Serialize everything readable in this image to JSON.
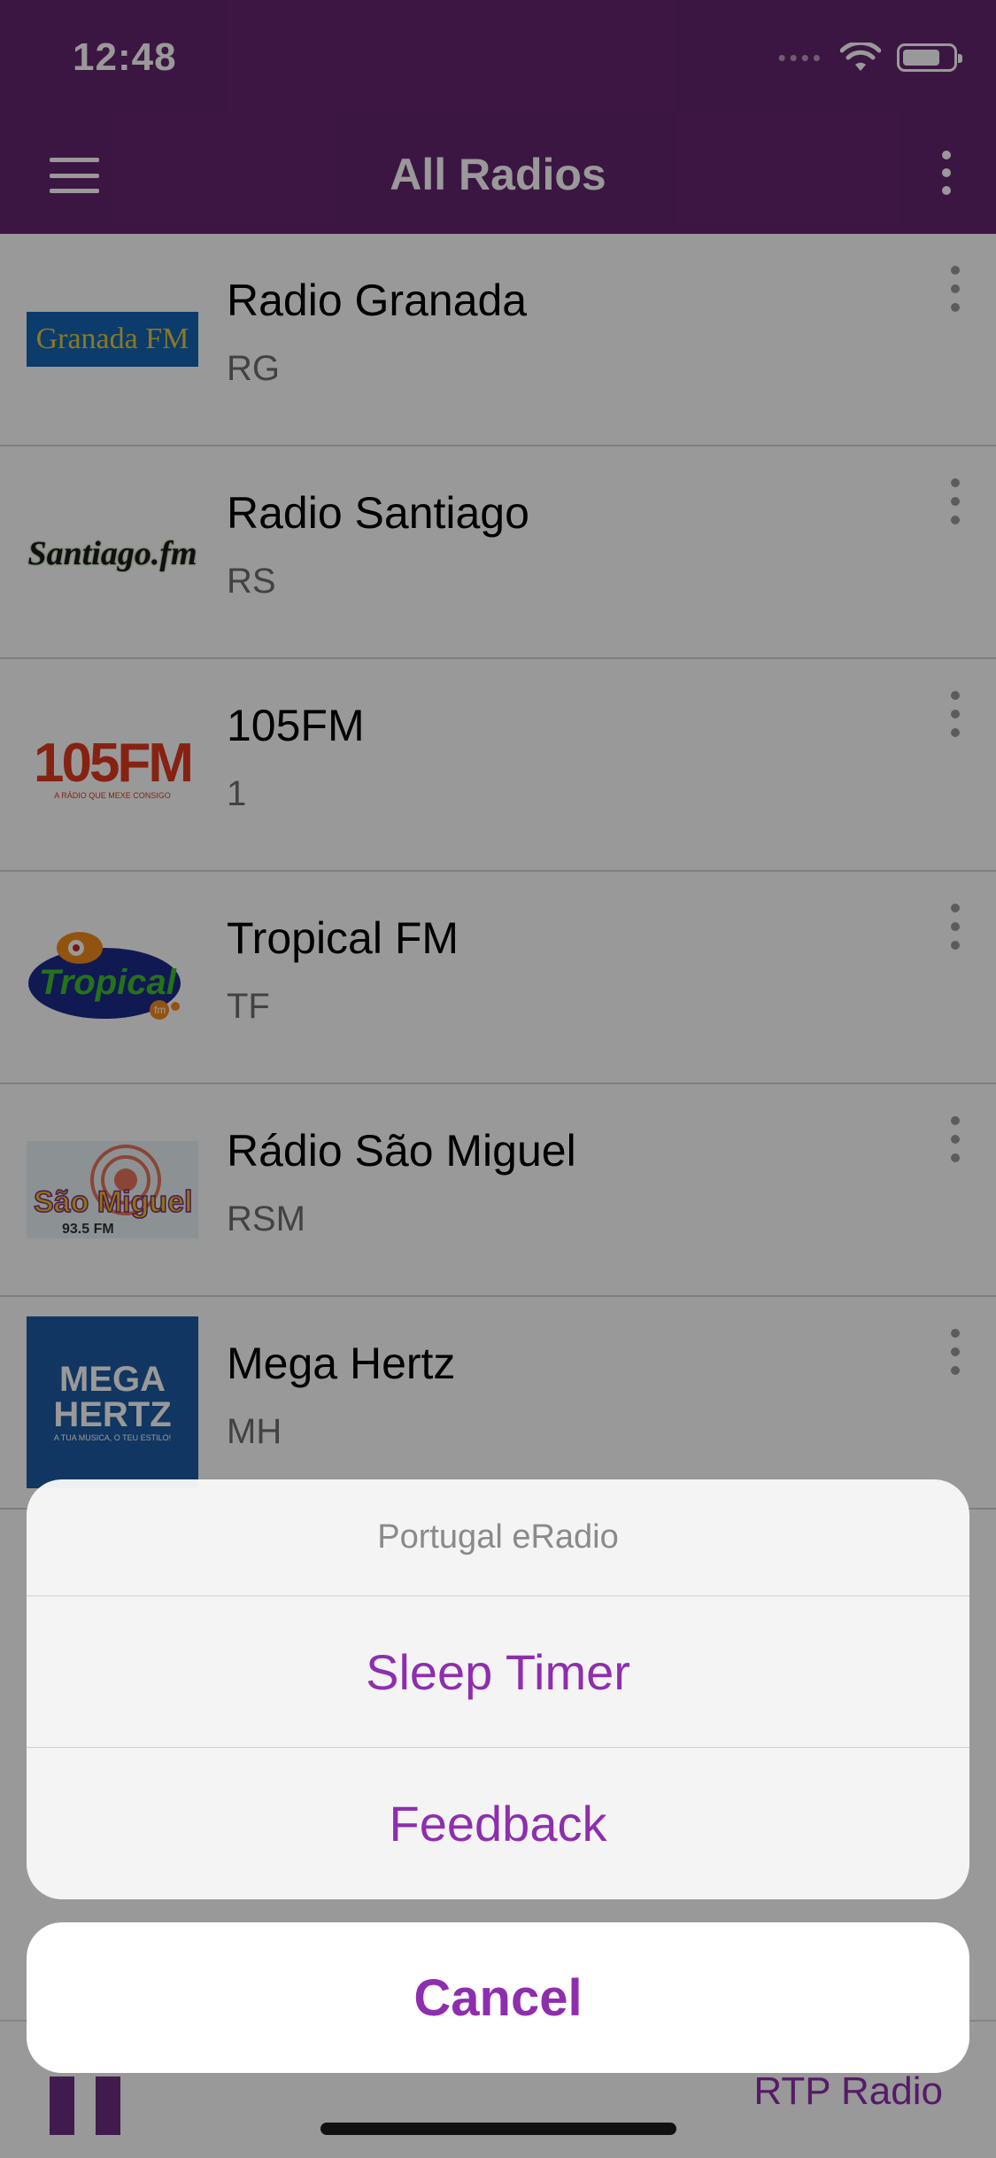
{
  "status_bar": {
    "time": "12:48",
    "signal": "••••",
    "battery_level": 0.75
  },
  "nav": {
    "title": "All Radios",
    "menu_icon": "hamburger-icon",
    "more_icon": "more-vertical-icon"
  },
  "stations": [
    {
      "name": "Radio Granada",
      "code": "RG",
      "logo_text": "Granada FM"
    },
    {
      "name": "Radio Santiago",
      "code": "RS",
      "logo_text": "Santiago.fm"
    },
    {
      "name": "105FM",
      "code": "1",
      "logo_text": "105FM",
      "logo_tagline": "A RÁDIO QUE MEXE CONSIGO"
    },
    {
      "name": "Tropical FM",
      "code": "TF",
      "logo_text": "Tropical",
      "logo_sub": "fm"
    },
    {
      "name": "Rádio São Miguel",
      "code": "RSM",
      "logo_text": "São Miguel",
      "logo_sub": "93.5 FM"
    },
    {
      "name": "Mega Hertz",
      "code": "MH",
      "logo_line1": "MEGA",
      "logo_line2": "HERTZ",
      "logo_tagline": "A TUA MUSICA, O TEU ESTILO!"
    }
  ],
  "player": {
    "now_playing": "RTP Radio",
    "state_icon": "pause-icon"
  },
  "action_sheet": {
    "title": "Portugal eRadio",
    "actions": [
      "Sleep Timer",
      "Feedback"
    ],
    "cancel": "Cancel"
  },
  "colors": {
    "brand": "#65256f",
    "accent": "#8e2eae"
  }
}
